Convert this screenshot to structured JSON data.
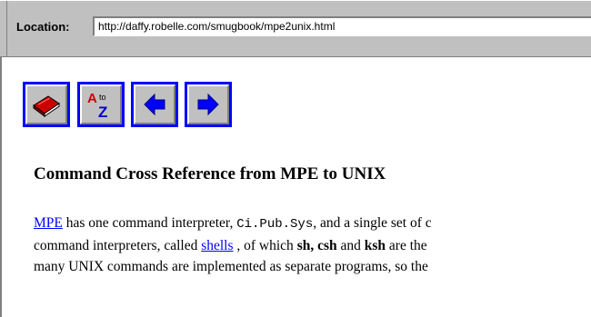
{
  "location_bar": {
    "label": "Location:",
    "url": "http://daffy.robelle.com/smugbook/mpe2unix.html"
  },
  "nav": {
    "buttons": [
      {
        "name": "book-icon"
      },
      {
        "name": "a-to-z-icon",
        "glyph_a": "A",
        "glyph_to": "to",
        "glyph_z": "Z"
      },
      {
        "name": "arrow-left-icon"
      },
      {
        "name": "arrow-right-icon"
      }
    ]
  },
  "page": {
    "heading": "Command Cross Reference from MPE to UNIX",
    "para": {
      "line1": {
        "link": "MPE",
        "t1": " has one command interpreter, ",
        "code": "Ci.Pub.Sys",
        "t2": ", and a single set of c"
      },
      "line2": {
        "t1": "command interpreters, called ",
        "link": "shells",
        "t2": " , of which ",
        "b1": "sh, csh",
        "t3": " and ",
        "b2": "ksh",
        "t4": " are the"
      },
      "line3": {
        "t1": "many UNIX commands are implemented as separate programs, so the"
      }
    }
  },
  "colors": {
    "chrome": "#c0c0c0",
    "link": "#0000ff",
    "button_border": "#0000ff"
  }
}
